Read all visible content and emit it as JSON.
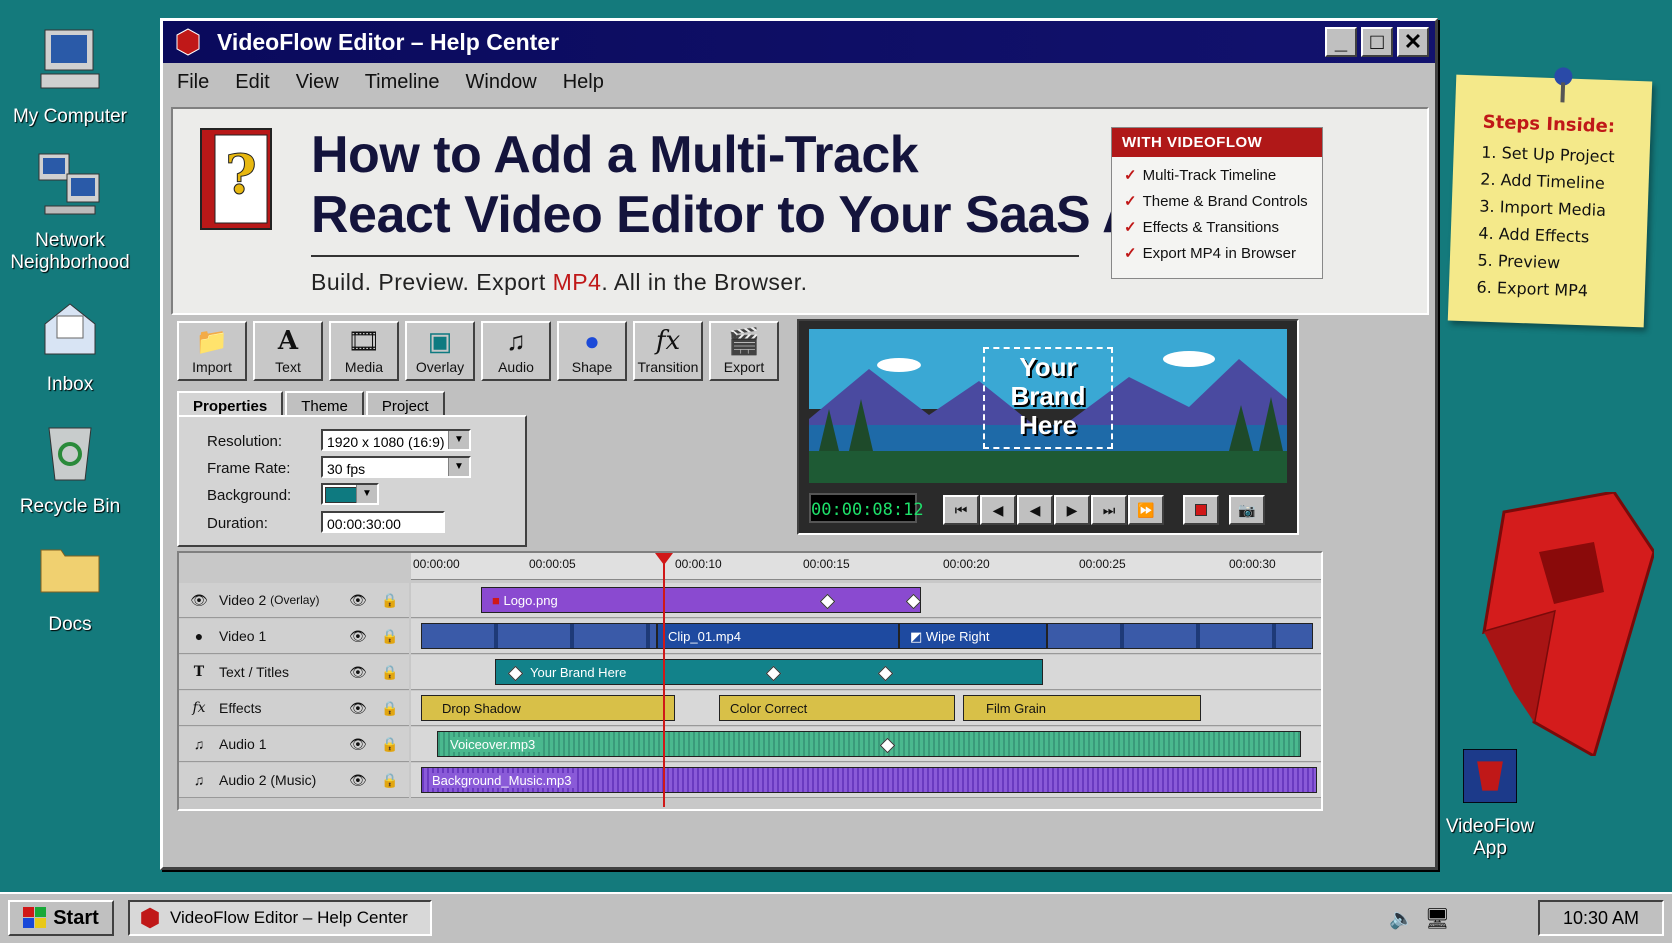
{
  "desktop": {
    "icons": [
      {
        "label": "My Computer"
      },
      {
        "label": "Network\nNeighborhood"
      },
      {
        "label": "Inbox"
      },
      {
        "label": "Recycle Bin"
      },
      {
        "label": "Docs"
      },
      {
        "label": "VideoFlow\nApp"
      }
    ]
  },
  "window": {
    "title": "VideoFlow Editor – Help Center",
    "menu": [
      "File",
      "Edit",
      "View",
      "Timeline",
      "Window",
      "Help"
    ]
  },
  "hero": {
    "title_line1": "How to Add a Multi-Track",
    "title_line2": "React Video Editor to Your SaaS App",
    "subtitle_a": "Build. Preview. Export ",
    "subtitle_mp4": "MP4",
    "subtitle_b": ". All in the Browser.",
    "features_head": "WITH VIDEOFLOW",
    "features": [
      "Multi-Track Timeline",
      "Theme & Brand Controls",
      "Effects & Transitions",
      "Export MP4 in Browser"
    ]
  },
  "toolbar": [
    {
      "label": "Import",
      "icon": "folder-icon"
    },
    {
      "label": "Text",
      "icon": "text-icon"
    },
    {
      "label": "Media",
      "icon": "film-icon"
    },
    {
      "label": "Overlay",
      "icon": "overlay-icon"
    },
    {
      "label": "Audio",
      "icon": "music-icon"
    },
    {
      "label": "Shape",
      "icon": "circle-icon"
    },
    {
      "label": "Transition",
      "icon": "fx-icon"
    },
    {
      "label": "Export",
      "icon": "clapper-icon"
    }
  ],
  "tabs": [
    "Properties",
    "Theme",
    "Project"
  ],
  "properties": {
    "resolution_label": "Resolution:",
    "resolution_value": "1920 x 1080 (16:9)",
    "framerate_label": "Frame Rate:",
    "framerate_value": "30 fps",
    "background_label": "Background:",
    "background_color": "#0e7a80",
    "duration_label": "Duration:",
    "duration_value": "00:00:30:00"
  },
  "preview": {
    "overlay_text": "Your\nBrand\nHere",
    "timecode": "00:00:08:12"
  },
  "timeline": {
    "ticks": [
      "00:00:00",
      "00:00:05",
      "00:00:10",
      "00:00:15",
      "00:00:20",
      "00:00:25",
      "00:00:30"
    ],
    "tracks": [
      {
        "name": "Video 2",
        "sub": "(Overlay)",
        "icon": "eye-icon"
      },
      {
        "name": "Video 1",
        "sub": "",
        "icon": "eye-filled-icon"
      },
      {
        "name": "Text / Titles",
        "sub": "",
        "icon": "text-icon"
      },
      {
        "name": "Effects",
        "sub": "",
        "icon": "fx-icon"
      },
      {
        "name": "Audio 1",
        "sub": "",
        "icon": "music-icon"
      },
      {
        "name": "Audio 2 (Music)",
        "sub": "",
        "icon": "music-icon"
      }
    ],
    "clips": {
      "logo": "Logo.png",
      "clip01": "Clip_01.mp4",
      "wipe": "Wipe Right",
      "brand": "Your Brand Here",
      "shadow": "Drop Shadow",
      "color": "Color Correct",
      "grain": "Film Grain",
      "voice": "Voiceover.mp3",
      "music": "Background_Music.mp3"
    }
  },
  "sticky": {
    "title": "Steps Inside:",
    "steps": [
      "Set Up Project",
      "Add Timeline",
      "Import Media",
      "Add Effects",
      "Preview",
      "Export MP4"
    ]
  },
  "taskbar": {
    "start": "Start",
    "task": "VideoFlow Editor – Help Center",
    "clock": "10:30 AM"
  }
}
